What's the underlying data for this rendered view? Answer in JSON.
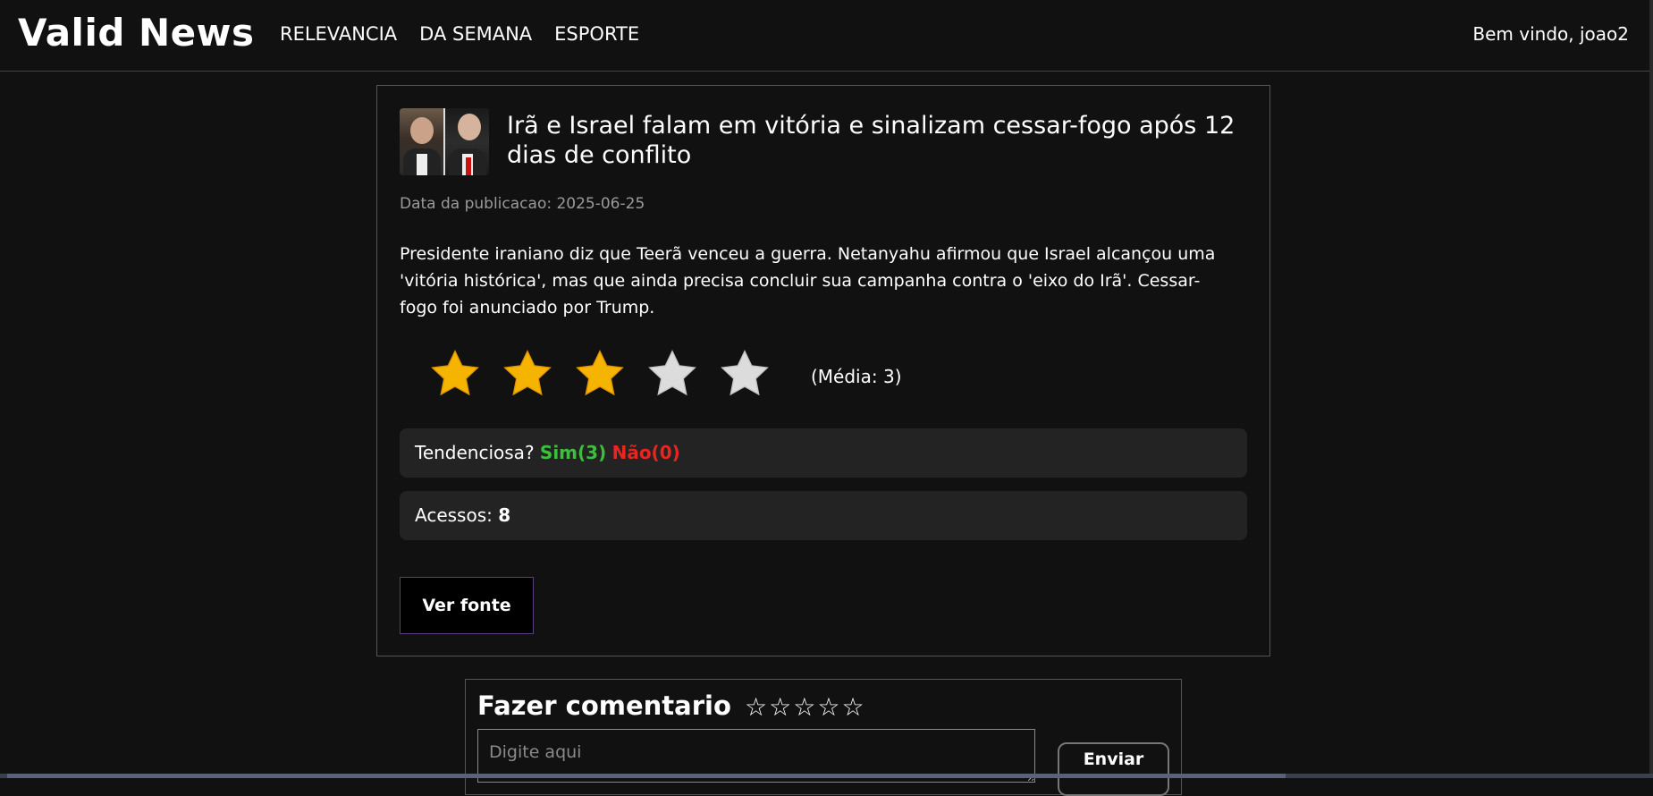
{
  "navbar": {
    "brand": "Valid News",
    "links": [
      "RELEVANCIA",
      "DA SEMANA",
      "ESPORTE"
    ],
    "welcome": "Bem vindo, joao2"
  },
  "article": {
    "title": "Irã e Israel falam em vitória e sinalizam cessar-fogo após 12 dias de conflito",
    "pubdate": "Data da publicacao: 2025-06-25",
    "summary": "Presidente iraniano diz que Teerã venceu a guerra. Netanyahu afirmou que Israel alcançou uma 'vitória histórica', mas que ainda precisa concluir sua campanha contra o 'eixo do Irã'. Cessar-fogo foi anunciado por Trump.",
    "rating": {
      "value": 3,
      "max": 5,
      "average_label": "(Média: 3)"
    },
    "bias": {
      "label": "Tendenciosa?",
      "yes": "Sim(3)",
      "no": "Não(0)"
    },
    "access": {
      "label": "Acessos:",
      "count": "8"
    },
    "source_button": "Ver fonte"
  },
  "comment": {
    "title": "Fazer comentario",
    "stars": [
      "☆",
      "☆",
      "☆",
      "☆",
      "☆"
    ],
    "placeholder": "Digite aqui",
    "send_button": "Enviar"
  },
  "colors": {
    "background": "#111111",
    "yes": "#3dbf3d",
    "no": "#e8251f",
    "star_filled": "#f5b400",
    "star_empty": "#dcdcdc"
  }
}
